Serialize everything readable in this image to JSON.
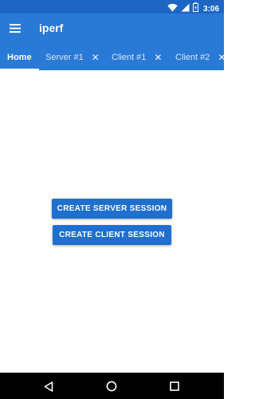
{
  "status_bar": {
    "time": "3:06",
    "icons": [
      "wifi-icon",
      "signal-icon",
      "battery-icon"
    ]
  },
  "toolbar": {
    "title": "iperf",
    "menu_icon": "hamburger-menu-icon"
  },
  "tabs": [
    {
      "label": "Home",
      "active": true,
      "closable": false
    },
    {
      "label": "Server #1",
      "active": false,
      "closable": true
    },
    {
      "label": "Client #1",
      "active": false,
      "closable": true
    },
    {
      "label": "Client #2",
      "active": false,
      "closable": true
    }
  ],
  "main": {
    "create_server_label": "CREATE SERVER SESSION",
    "create_client_label": "CREATE CLIENT SESSION"
  },
  "nav_bar": {
    "icons": [
      "back-icon",
      "home-icon",
      "recents-icon"
    ]
  },
  "colors": {
    "status_bar": "#1e66c4",
    "app_bar": "#2979d6",
    "button": "#1f6fd0"
  }
}
